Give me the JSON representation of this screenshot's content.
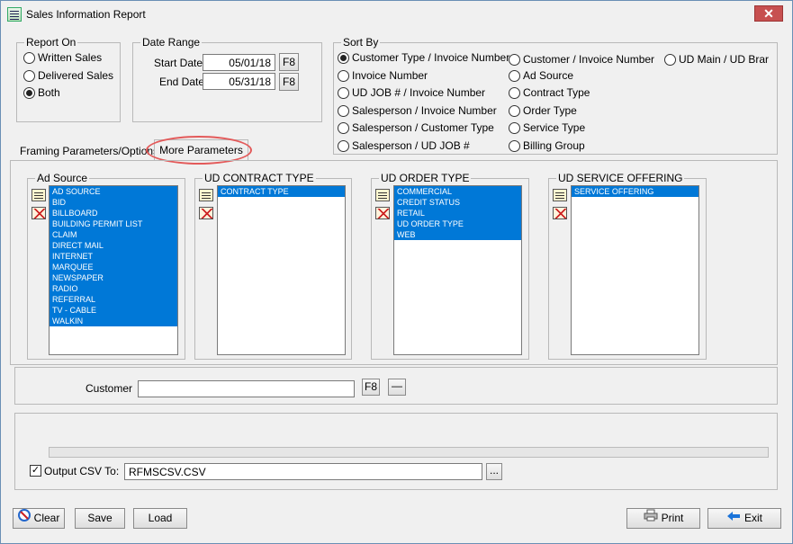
{
  "window": {
    "title": "Sales Information Report",
    "close_glyph": "✕"
  },
  "report_on": {
    "title": "Report On",
    "options": [
      {
        "label": "Written Sales",
        "selected": false
      },
      {
        "label": "Delivered Sales",
        "selected": false
      },
      {
        "label": "Both",
        "selected": true
      }
    ]
  },
  "date_range": {
    "title": "Date Range",
    "start_label": "Start Date",
    "start_value": "05/01/18",
    "end_label": "End Date",
    "end_value": "05/31/18",
    "f8_label": "F8"
  },
  "sort_by": {
    "title": "Sort By",
    "options": [
      {
        "label": "Customer Type / Invoice Number",
        "selected": true
      },
      {
        "label": "Invoice Number",
        "selected": false
      },
      {
        "label": "UD JOB # / Invoice Number",
        "selected": false
      },
      {
        "label": "Salesperson / Invoice Number",
        "selected": false
      },
      {
        "label": "Salesperson / Customer Type",
        "selected": false
      },
      {
        "label": "Salesperson / UD JOB #",
        "selected": false
      },
      {
        "label": "Customer / Invoice Number",
        "selected": false
      },
      {
        "label": "Ad Source",
        "selected": false
      },
      {
        "label": "Contract Type",
        "selected": false
      },
      {
        "label": "Order Type",
        "selected": false
      },
      {
        "label": "Service Type",
        "selected": false
      },
      {
        "label": "Billing Group",
        "selected": false
      },
      {
        "label": "UD Main / UD Brar",
        "selected": false
      }
    ]
  },
  "tabs": [
    {
      "label": "Framing Parameters/Options",
      "active": false
    },
    {
      "label": "More Parameters",
      "active": true
    }
  ],
  "lists": {
    "ad_source": {
      "title": "Ad Source",
      "items": [
        "AD SOURCE",
        "BID",
        "BILLBOARD",
        "BUILDING PERMIT LIST",
        "CLAIM",
        "DIRECT MAIL",
        "INTERNET",
        "MARQUEE",
        "NEWSPAPER",
        "RADIO",
        "REFERRAL",
        "TV - CABLE",
        "WALKIN"
      ]
    },
    "contract_type": {
      "title": "UD CONTRACT TYPE",
      "items": [
        "CONTRACT TYPE"
      ]
    },
    "order_type": {
      "title": "UD ORDER TYPE",
      "items": [
        "COMMERCIAL",
        "CREDIT STATUS",
        "RETAIL",
        "UD ORDER TYPE",
        "WEB"
      ]
    },
    "service_offering": {
      "title": "UD SERVICE OFFERING",
      "items": [
        "SERVICE OFFERING"
      ]
    }
  },
  "customer": {
    "label": "Customer",
    "value": "",
    "f8_label": "F8",
    "dash_label": "—"
  },
  "output": {
    "checked": true,
    "check_glyph": "✓",
    "label": "Output CSV To:",
    "value": "RFMSCSV.CSV",
    "browse_label": "..."
  },
  "progress": 0,
  "buttons": {
    "clear": "Clear",
    "save": "Save",
    "load": "Load",
    "print": "Print",
    "exit": "Exit"
  },
  "icons": {
    "clear": "clear-icon",
    "print": "printer-icon",
    "exit": "exit-arrow-icon",
    "select_all": "select-all-icon",
    "clear_selection": "clear-selection-icon"
  },
  "colors": {
    "selection": "#0078d7",
    "highlight_oval": "#e35a5a",
    "close_button": "#c75050"
  }
}
